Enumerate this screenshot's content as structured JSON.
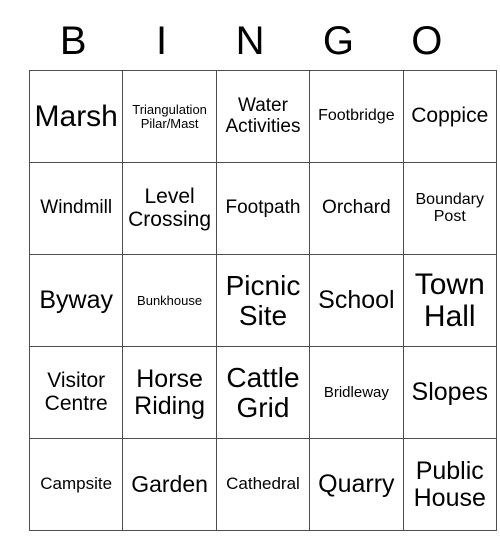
{
  "card": {
    "title": "BINGO",
    "header_letters": [
      "B",
      "I",
      "N",
      "G",
      "O"
    ],
    "columns": 5,
    "rows": 5,
    "border_color": "#4d4d4d",
    "background_color": "#ffffff",
    "text_color": "#000000",
    "cells": [
      [
        {
          "label": "Marsh",
          "size": "4xl"
        },
        {
          "label": "Triangulation Pilar/Mast",
          "size": "xs"
        },
        {
          "label": "Water Activities",
          "size": "ml"
        },
        {
          "label": "Footbridge",
          "size": "sm"
        },
        {
          "label": "Coppice",
          "size": "l"
        }
      ],
      [
        {
          "label": "Windmill",
          "size": "ml"
        },
        {
          "label": "Level Crossing",
          "size": "l"
        },
        {
          "label": "Footpath",
          "size": "ml"
        },
        {
          "label": "Orchard",
          "size": "ml"
        },
        {
          "label": "Boundary Post",
          "size": "sm"
        }
      ],
      [
        {
          "label": "Byway",
          "size": "xxl"
        },
        {
          "label": "Bunkhouse",
          "size": "xs"
        },
        {
          "label": "Picnic Site",
          "size": "3xl"
        },
        {
          "label": "School",
          "size": "xxl"
        },
        {
          "label": "Town Hall",
          "size": "4xl"
        }
      ],
      [
        {
          "label": "Visitor Centre",
          "size": "l"
        },
        {
          "label": "Horse Riding",
          "size": "xxl"
        },
        {
          "label": "Cattle Grid",
          "size": "3xl"
        },
        {
          "label": "Bridleway",
          "size": "s"
        },
        {
          "label": "Slopes",
          "size": "xxl"
        }
      ],
      [
        {
          "label": "Campsite",
          "size": "m"
        },
        {
          "label": "Garden",
          "size": "xl"
        },
        {
          "label": "Cathedral",
          "size": "m"
        },
        {
          "label": "Quarry",
          "size": "xxl"
        },
        {
          "label": "Public House",
          "size": "xxl"
        }
      ]
    ]
  }
}
